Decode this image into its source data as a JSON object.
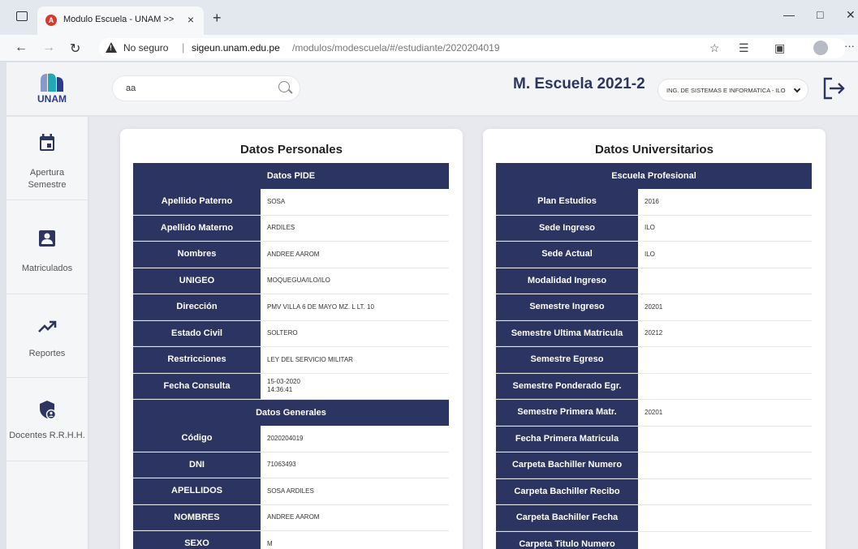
{
  "browser": {
    "tab_title": "Modulo Escuela - UNAM >>",
    "tab_close": "×",
    "new_tab": "+",
    "not_secure": "No seguro",
    "url_separator": "|",
    "url_host": "sigeun.unam.edu.pe",
    "url_path": "/modulos/modescuela/#/estudiante/2020204019",
    "more": "···"
  },
  "header": {
    "logo_text": "UNAM",
    "search_value": "aa",
    "title": "M. Escuela 2021-2",
    "school_selected": "ING. DE SISTEMAS E INFORMATICA - ILO"
  },
  "sidebar": {
    "items": [
      {
        "label": "Apertura Semestre",
        "icon": "calendar-icon"
      },
      {
        "label": "Matriculados",
        "icon": "user-badge-icon"
      },
      {
        "label": "Reportes",
        "icon": "trending-up-icon"
      },
      {
        "label": "Docentes R.R.H.H.",
        "icon": "shield-user-icon"
      }
    ]
  },
  "personal": {
    "title": "Datos Personales",
    "pide_header": "Datos PIDE",
    "pide_rows": [
      {
        "key": "Apellido Paterno",
        "value": "SOSA"
      },
      {
        "key": "Apellido Materno",
        "value": "ARDILES"
      },
      {
        "key": "Nombres",
        "value": "ANDREE AAROM"
      },
      {
        "key": "UNIGEO",
        "value": "MOQUEGUA/ILO/ILO"
      },
      {
        "key": "Dirección",
        "value": "PMV VILLA 6 DE MAYO MZ. L LT. 10"
      },
      {
        "key": "Estado Civil",
        "value": "SOLTERO"
      },
      {
        "key": "Restricciones",
        "value": "LEY DEL SERVICIO MILITAR"
      },
      {
        "key": "Fecha Consulta",
        "value": "15-03-2020",
        "value2": "14:36:41"
      }
    ],
    "general_header": "Datos Generales",
    "general_rows": [
      {
        "key": "Código",
        "value": "2020204019"
      },
      {
        "key": "DNI",
        "value": "71063493"
      },
      {
        "key": "APELLIDOS",
        "value": "SOSA ARDILES"
      },
      {
        "key": "NOMBRES",
        "value": "ANDREE AAROM"
      },
      {
        "key": "SEXO",
        "value": "M"
      }
    ]
  },
  "university": {
    "title": "Datos Universitarios",
    "header": "Escuela Profesional",
    "rows": [
      {
        "key": "Plan Estudios",
        "value": "2016"
      },
      {
        "key": "Sede Ingreso",
        "value": "ILO"
      },
      {
        "key": "Sede Actual",
        "value": "ILO"
      },
      {
        "key": "Modalidad Ingreso",
        "value": ""
      },
      {
        "key": "Semestre Ingreso",
        "value": "20201"
      },
      {
        "key": "Semestre Ultima Matricula",
        "value": "20212"
      },
      {
        "key": "Semestre Egreso",
        "value": ""
      },
      {
        "key": "Semestre Ponderado Egr.",
        "value": ""
      },
      {
        "key": "Semestre Primera Matr.",
        "value": "20201"
      },
      {
        "key": "Fecha Primera Matricula",
        "value": ""
      },
      {
        "key": "Carpeta Bachiller Numero",
        "value": ""
      },
      {
        "key": "Carpeta Bachiller Recibo",
        "value": ""
      },
      {
        "key": "Carpeta Bachiller Fecha",
        "value": ""
      },
      {
        "key": "Carpeta Titulo Numero",
        "value": ""
      }
    ]
  },
  "colors": {
    "table_header": "#2c3461",
    "title_text": "#2d3561",
    "logo_blue": "#2c3c8c",
    "logo_teal": "#21a8b7"
  }
}
